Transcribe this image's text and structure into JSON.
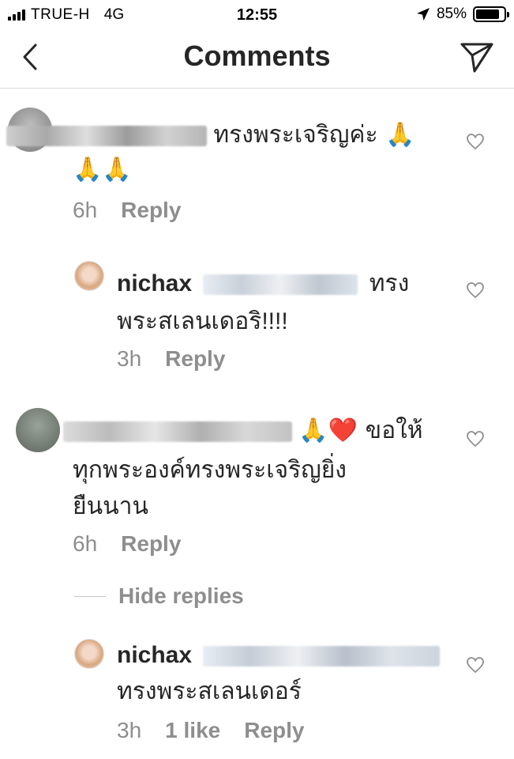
{
  "status_bar": {
    "carrier": "TRUE-H",
    "network": "4G",
    "time": "12:55",
    "battery_percent": "85%",
    "battery_level": 0.85
  },
  "header": {
    "title": "Comments"
  },
  "comments": [
    {
      "text_line1": "ทรงพระเจริญค่ะ 🙏",
      "text_line2": "🙏🙏",
      "time": "6h",
      "reply_label": "Reply",
      "reply": {
        "username": "nichax",
        "text_line1": "ทรง",
        "text_line2": "พระสเลนเดอริ!!!!",
        "time": "3h",
        "reply_label": "Reply"
      }
    },
    {
      "text_line1": "🙏❤️ ขอให้",
      "text_line2": "ทุกพระองค์ทรงพระเจริญยิ่ง",
      "text_line3": "ยืนนาน",
      "time": "6h",
      "reply_label": "Reply",
      "hide_replies_label": "Hide replies",
      "reply": {
        "username": "nichax",
        "text_line2": "ทรงพระสเลนเดอร์",
        "time": "3h",
        "likes": "1 like",
        "reply_label": "Reply"
      }
    }
  ],
  "colors": {
    "text": "#262626",
    "meta": "#8e8e8e",
    "divider": "#dbdbdb"
  }
}
